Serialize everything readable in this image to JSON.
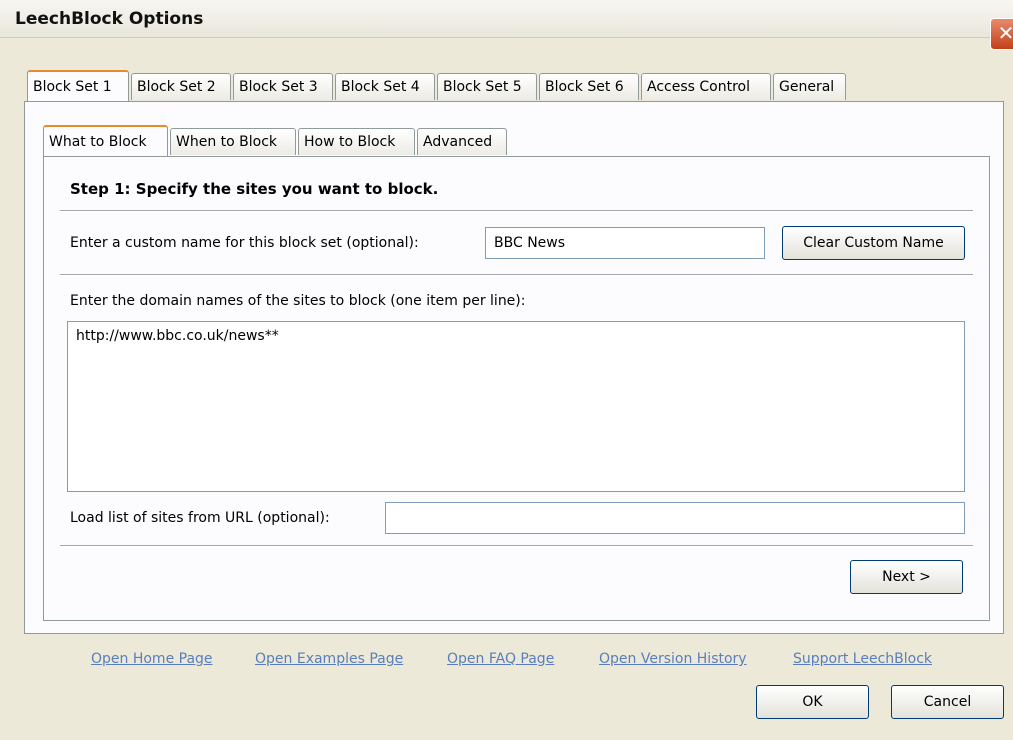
{
  "window": {
    "title": "LeechBlock Options",
    "close_glyph": "✕"
  },
  "main_tabs": [
    {
      "label": "Block Set 1",
      "active": true
    },
    {
      "label": "Block Set 2"
    },
    {
      "label": "Block Set 3"
    },
    {
      "label": "Block Set 4"
    },
    {
      "label": "Block Set 5"
    },
    {
      "label": "Block Set 6"
    },
    {
      "label": "Access Control"
    },
    {
      "label": "General"
    }
  ],
  "sub_tabs": [
    {
      "label": "What to Block",
      "active": true
    },
    {
      "label": "When to Block"
    },
    {
      "label": "How to Block"
    },
    {
      "label": "Advanced"
    }
  ],
  "panel": {
    "step_title": "Step 1: Specify the sites you want to block.",
    "custom_name_label": "Enter a custom name for this block set (optional):",
    "custom_name_value": "BBC News",
    "clear_button": "Clear Custom Name",
    "domains_label": "Enter the domain names of the sites to block (one item per line):",
    "domains_value": "http://www.bbc.co.uk/news**",
    "url_label": "Load list of sites from URL (optional):",
    "url_value": "",
    "next_button": "Next >"
  },
  "footer_links": [
    "Open Home Page",
    "Open Examples Page",
    "Open FAQ Page",
    "Open Version History",
    "Support LeechBlock"
  ],
  "buttons": {
    "ok": "OK",
    "cancel": "Cancel"
  }
}
